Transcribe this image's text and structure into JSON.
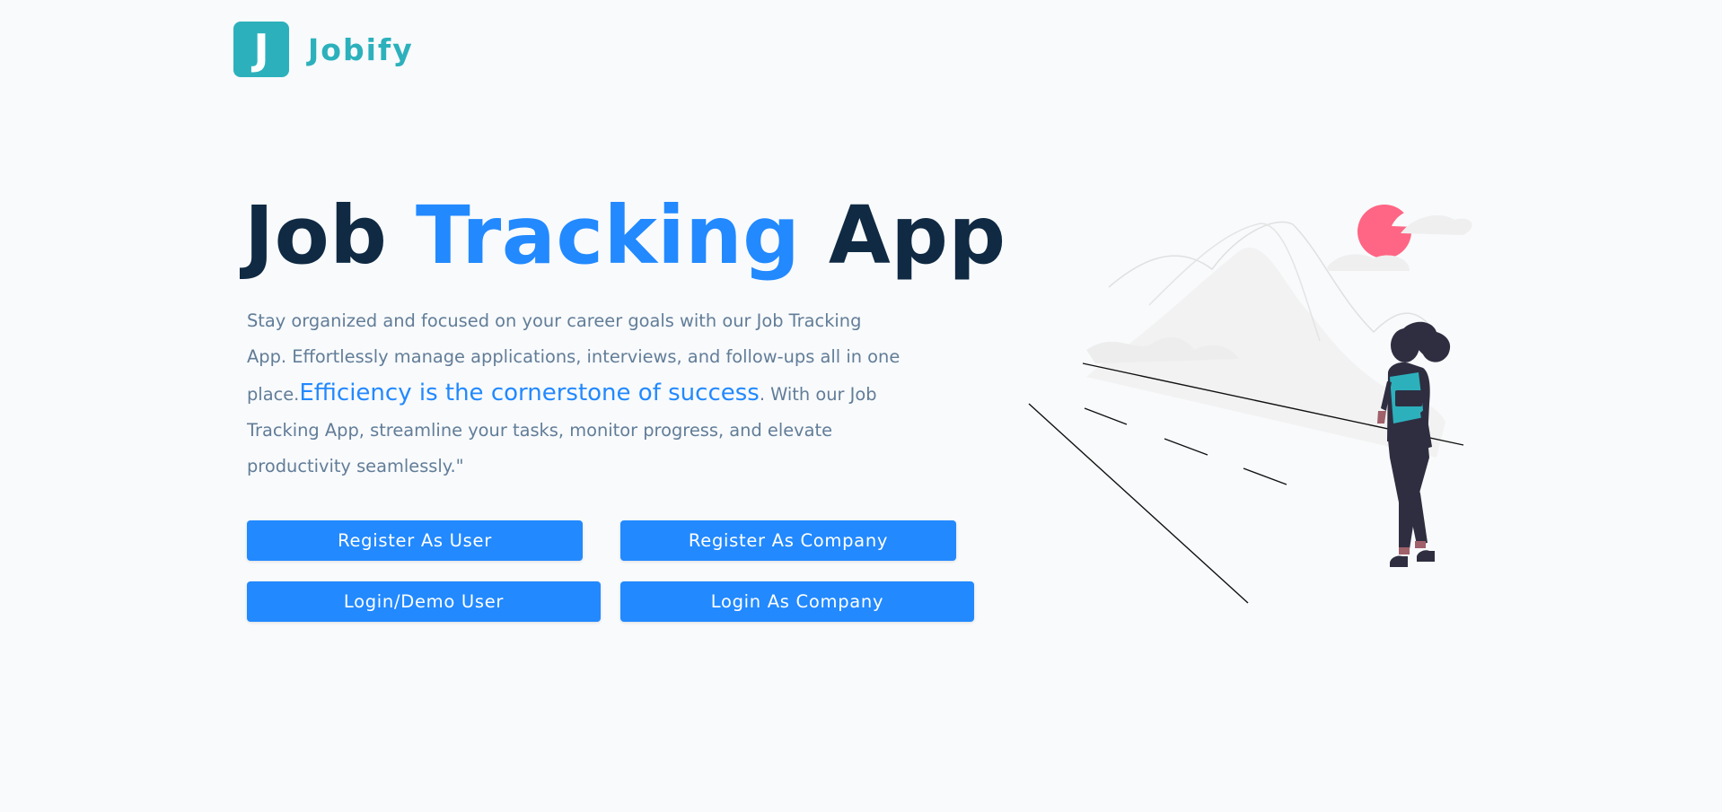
{
  "brand": {
    "logo_letter": "J",
    "name": "Jobify",
    "color": "#2cb1bc"
  },
  "hero": {
    "title_part1": "Job ",
    "title_accent": "Tracking",
    "title_part2": " App",
    "text_before": "Stay organized and focused on your career goals with our Job Tracking App. Effortlessly manage applications, interviews, and follow-ups all in one place.",
    "text_highlight": "Efficiency is the cornerstone of success",
    "text_after": ". With our Job Tracking App, streamline your tasks, monitor progress, and elevate productivity seamlessly.\""
  },
  "buttons": {
    "register_user": "Register As User",
    "register_company": "Register As Company",
    "login_user": "Login/Demo User",
    "login_company": "Login As Company"
  },
  "colors": {
    "primary": "#2289ff",
    "heading": "#102a43",
    "body_text": "#627d98",
    "background": "#f8fafc",
    "sun": "#ff6584",
    "illustration_accent": "#2cb1bc"
  },
  "illustration": {
    "icon": "woman-on-road-illustration"
  }
}
